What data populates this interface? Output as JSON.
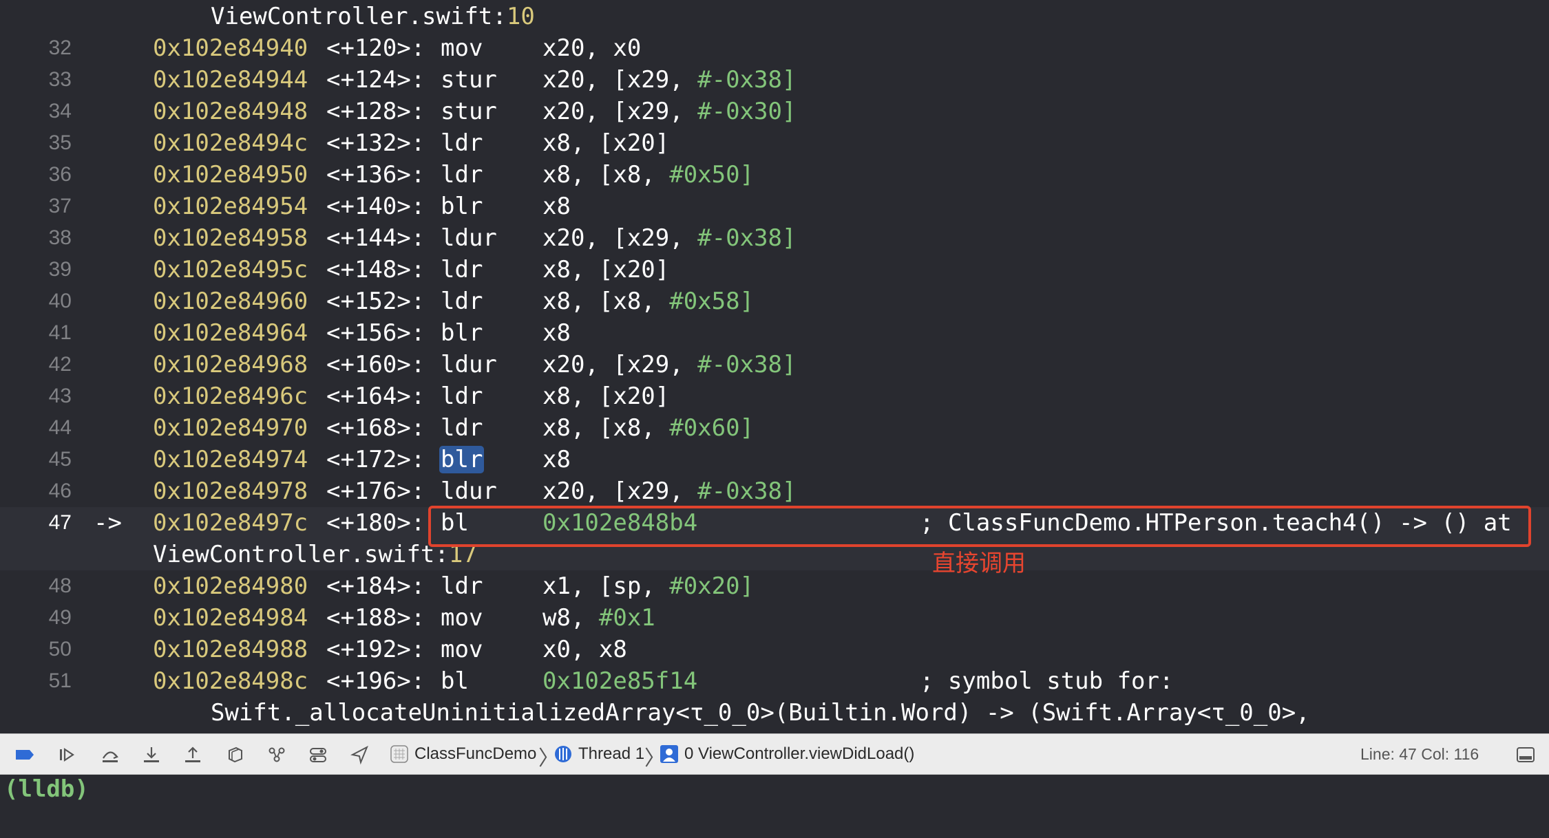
{
  "editor": {
    "header": {
      "file": "ViewController.swift:",
      "line": "10"
    },
    "rows": [
      {
        "ln": "32",
        "addr": "0x102e84940",
        "off": "<+120>:",
        "mn": "mov",
        "ops": [
          "x20, x0"
        ]
      },
      {
        "ln": "33",
        "addr": "0x102e84944",
        "off": "<+124>:",
        "mn": "stur",
        "ops": [
          "x20, [x29, ",
          "#-0x38]"
        ]
      },
      {
        "ln": "34",
        "addr": "0x102e84948",
        "off": "<+128>:",
        "mn": "stur",
        "ops": [
          "x20, [x29, ",
          "#-0x30]"
        ]
      },
      {
        "ln": "35",
        "addr": "0x102e8494c",
        "off": "<+132>:",
        "mn": "ldr",
        "ops": [
          "x8, [x20]"
        ]
      },
      {
        "ln": "36",
        "addr": "0x102e84950",
        "off": "<+136>:",
        "mn": "ldr",
        "ops": [
          "x8, [x8, ",
          "#0x50]"
        ]
      },
      {
        "ln": "37",
        "addr": "0x102e84954",
        "off": "<+140>:",
        "mn": "blr",
        "ops": [
          "x8"
        ]
      },
      {
        "ln": "38",
        "addr": "0x102e84958",
        "off": "<+144>:",
        "mn": "ldur",
        "ops": [
          "x20, [x29, ",
          "#-0x38]"
        ]
      },
      {
        "ln": "39",
        "addr": "0x102e8495c",
        "off": "<+148>:",
        "mn": "ldr",
        "ops": [
          "x8, [x20]"
        ]
      },
      {
        "ln": "40",
        "addr": "0x102e84960",
        "off": "<+152>:",
        "mn": "ldr",
        "ops": [
          "x8, [x8, ",
          "#0x58]"
        ]
      },
      {
        "ln": "41",
        "addr": "0x102e84964",
        "off": "<+156>:",
        "mn": "blr",
        "ops": [
          "x8"
        ]
      },
      {
        "ln": "42",
        "addr": "0x102e84968",
        "off": "<+160>:",
        "mn": "ldur",
        "ops": [
          "x20, [x29, ",
          "#-0x38]"
        ]
      },
      {
        "ln": "43",
        "addr": "0x102e8496c",
        "off": "<+164>:",
        "mn": "ldr",
        "ops": [
          "x8, [x20]"
        ]
      },
      {
        "ln": "44",
        "addr": "0x102e84970",
        "off": "<+168>:",
        "mn": "ldr",
        "ops": [
          "x8, [x8, ",
          "#0x60]"
        ]
      },
      {
        "ln": "45",
        "addr": "0x102e84974",
        "off": "<+172>:",
        "mn": "blr",
        "ops": [
          "x8"
        ],
        "selected": true
      },
      {
        "ln": "46",
        "addr": "0x102e84978",
        "off": "<+176>:",
        "mn": "ldur",
        "ops": [
          "x20, [x29, ",
          "#-0x38]"
        ]
      },
      {
        "ln": "47",
        "addr": "0x102e8497c",
        "off": "<+180>:",
        "mn": "bl",
        "ops": [
          "0x102e848b4"
        ],
        "current": true,
        "arrow": "->",
        "comment": "; ClassFuncDemo.HTPerson.teach4() -> () at"
      },
      {
        "ln": "48",
        "addr": "0x102e84980",
        "off": "<+184>:",
        "mn": "ldr",
        "ops": [
          "x1, [sp, ",
          "#0x20]"
        ]
      },
      {
        "ln": "49",
        "addr": "0x102e84984",
        "off": "<+188>:",
        "mn": "mov",
        "ops": [
          "w8, ",
          "#0x1"
        ]
      },
      {
        "ln": "50",
        "addr": "0x102e84988",
        "off": "<+192>:",
        "mn": "mov",
        "ops": [
          "x0, x8"
        ]
      },
      {
        "ln": "51",
        "addr": "0x102e8498c",
        "off": "<+196>:",
        "mn": "bl",
        "ops": [
          "0x102e85f14"
        ],
        "comment": "; symbol stub for:"
      }
    ],
    "current_continuation": {
      "file": "ViewController.swift:",
      "line": "17"
    },
    "stub_continuation": "Swift._allocateUninitializedArray<τ_0_0>(Builtin.Word) -> (Swift.Array<τ_0_0>,",
    "annotation_note": "直接调用"
  },
  "debugbar": {
    "breadcrumb": {
      "target": "ClassFuncDemo",
      "thread": "Thread 1",
      "frame": "0 ViewController.viewDidLoad()"
    },
    "line_col": "Line: 47  Col: 116",
    "colors": {
      "breakpoint_active": "#2f6bd6",
      "bar_bg": "#ececec"
    }
  },
  "console": {
    "prompt": "(lldb)"
  },
  "colors": {
    "background": "#292a30",
    "address": "#d9c97c",
    "immediate": "#83c57a",
    "annotation": "#e0432d",
    "selection": "#2f5a9c"
  }
}
